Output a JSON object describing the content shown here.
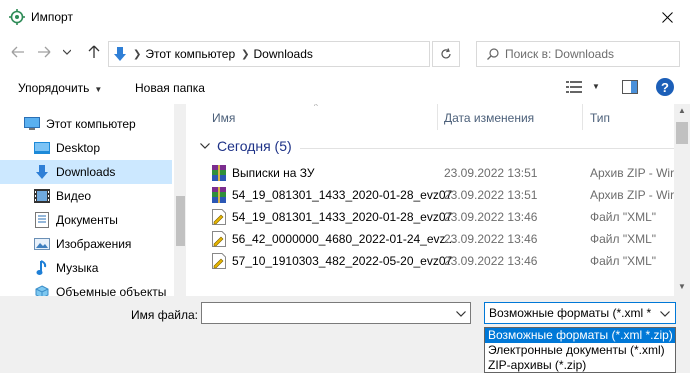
{
  "window": {
    "title": "Импорт"
  },
  "address": {
    "segments": [
      "Этот компьютер",
      "Downloads"
    ]
  },
  "search": {
    "placeholder": "Поиск в: Downloads"
  },
  "toolbar": {
    "organize_label": "Упорядочить",
    "new_folder_label": "Новая папка"
  },
  "sidebar": {
    "items": [
      {
        "label": "Этот компьютер",
        "icon": "computer-icon"
      },
      {
        "label": "Desktop",
        "icon": "desktop-folder-icon"
      },
      {
        "label": "Downloads",
        "icon": "download-arrow-icon",
        "selected": true
      },
      {
        "label": "Видео",
        "icon": "video-folder-icon"
      },
      {
        "label": "Документы",
        "icon": "documents-folder-icon"
      },
      {
        "label": "Изображения",
        "icon": "pictures-folder-icon"
      },
      {
        "label": "Музыка",
        "icon": "music-note-icon"
      },
      {
        "label": "Объемные объекты",
        "icon": "3d-objects-icon"
      }
    ]
  },
  "columns": {
    "name": "Имя",
    "date": "Дата изменения",
    "type": "Тип"
  },
  "group": {
    "label": "Сегодня (5)"
  },
  "files": [
    {
      "name": "Выписки на ЗУ",
      "date": "23.09.2022 13:51",
      "type": "Архив ZIP - Wir",
      "icon": "winrar-archive-icon"
    },
    {
      "name": "54_19_081301_1433_2020-01-28_evz07",
      "date": "23.09.2022 13:51",
      "type": "Архив ZIP - Wir",
      "icon": "winrar-archive-icon"
    },
    {
      "name": "54_19_081301_1433_2020-01-28_evz07",
      "date": "23.09.2022 13:46",
      "type": "Файл \"XML\"",
      "icon": "xml-file-icon"
    },
    {
      "name": "56_42_0000000_4680_2022-01-24_evz...",
      "date": "23.09.2022 13:46",
      "type": "Файл \"XML\"",
      "icon": "xml-file-icon"
    },
    {
      "name": "57_10_1910303_482_2022-05-20_evz07",
      "date": "23.09.2022 13:46",
      "type": "Файл \"XML\"",
      "icon": "xml-file-icon"
    }
  ],
  "bottom": {
    "filename_label": "Имя файла:",
    "filename_value": "",
    "filter_selected": "Возможные форматы (*.xml *",
    "filter_options": [
      "Возможные форматы (*.xml *.zip)",
      "Электронные документы (*.xml)",
      "ZIP-архивы (*.zip)"
    ]
  },
  "colors": {
    "accent": "#0078d7",
    "selection": "#cce8ff",
    "group_text": "#1e3287"
  }
}
